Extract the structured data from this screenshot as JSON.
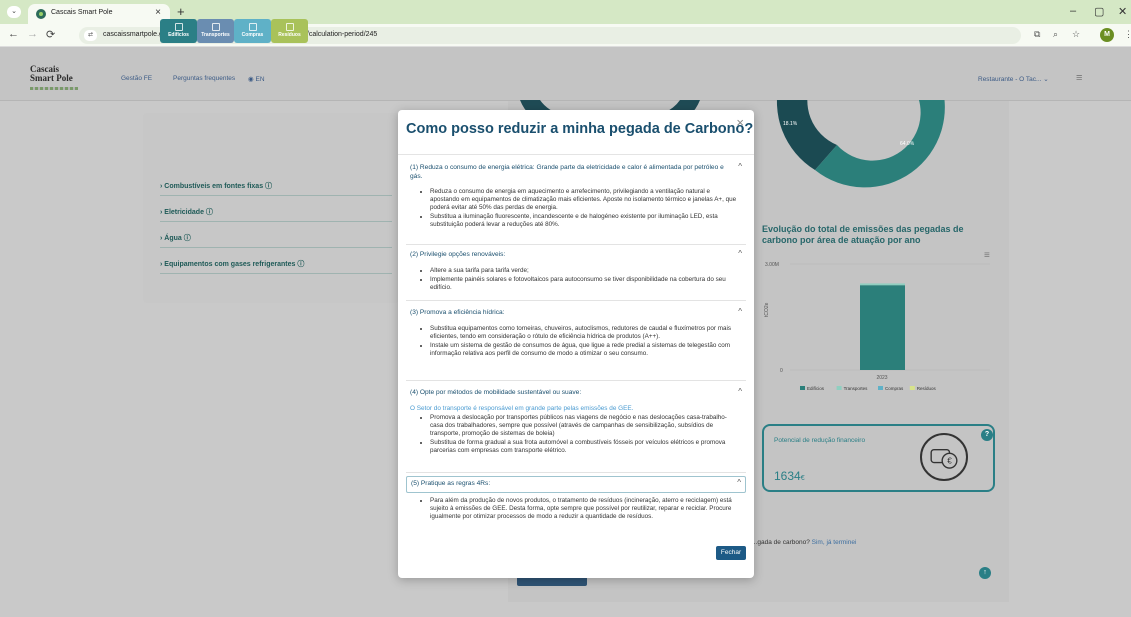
{
  "browser": {
    "tab_title": "Cascais Smart Pole",
    "url": "cascaissmartpole.get2zero.pt/collection-and-calculation/entity/101/calculation-period/245",
    "profile_initial": "M",
    "tab_close": "×",
    "new_tab": "+",
    "win_minimize": "–",
    "win_maximize": "▢",
    "win_close": "✕"
  },
  "app": {
    "logo_line1": "Cascais",
    "logo_line2": "Smart Pole",
    "nav": [
      "Gestão FE",
      "Perguntas frequentes"
    ],
    "lang": "EN",
    "restaurant_select": "Restaurante - O Tac...",
    "hamburger": "≡"
  },
  "categories": [
    {
      "label": "Edifícios",
      "color": "#2b7f86"
    },
    {
      "label": "Transportes",
      "color": "#6a8db1"
    },
    {
      "label": "Compras",
      "color": "#5fb1c7"
    },
    {
      "label": "Resíduos",
      "color": "#a9c25a"
    }
  ],
  "accordion": [
    "Combustíveis em fontes fixas",
    "Eletricidade",
    "Água",
    "Equipamentos com gases refrigerantes"
  ],
  "chart": {
    "title": "Evolução do total de emissões das pegadas de carbono por área de atuação por ano",
    "y_tick_top": "3.00M",
    "y_tick_bottom": "0",
    "y_label": "tCO2e",
    "x_label": "2023",
    "legend": [
      "Edifícios",
      "Transportes",
      "Compras",
      "Resíduos"
    ],
    "donut_labels": [
      "18.1%",
      "64.0%"
    ]
  },
  "chart_data": {
    "type": "bar",
    "categories": [
      "2023"
    ],
    "series": [
      {
        "name": "Edifícios",
        "values": [
          2.4
        ]
      },
      {
        "name": "Transportes",
        "values": [
          0.05
        ]
      },
      {
        "name": "Compras",
        "values": [
          0.0
        ]
      },
      {
        "name": "Resíduos",
        "values": [
          0.0
        ]
      }
    ],
    "ylim": [
      0,
      3.0
    ],
    "ylabel": "tCO2e",
    "title": "Evolução do total de emissões das pegadas de carbono por área de atuação por ano",
    "legend_placement": "bottom"
  },
  "financial": {
    "label": "Potencial de redução financeiro",
    "value": "1634",
    "unit": "€"
  },
  "bottom": {
    "question": "...gada de carbono?",
    "link": "Sim, já terminei"
  },
  "modal": {
    "title": "Como posso reduzir a minha pegada de Carbono?",
    "close": "×",
    "sections": [
      {
        "head": "(1) Reduza o consumo de energia elétrica: Grande parte da eletricidade e calor é alimentada por petróleo e gás.",
        "items": [
          "Reduza o consumo de energia em aquecimento e arrefecimento, privilegiando a ventilação natural e apostando em equipamentos de climatização mais eficientes. Aposte no isolamento térmico e janelas A+, que poderá evitar até 50% das perdas de energia.",
          "Substitua a iluminação fluorescente, incandescente e de halogéneo existente por iluminação LED, esta substituição poderá levar a reduções até 80%."
        ]
      },
      {
        "head": "(2) Privilegie opções renováveis:",
        "items": [
          "Altere a sua tarifa para tarifa verde;",
          "Implemente painéis solares e fotovoltaicos para autoconsumo se tiver disponibilidade na cobertura do seu edifício."
        ]
      },
      {
        "head": "(3) Promova a eficiência hídrica:",
        "items": [
          "Substitua equipamentos como torneiras, chuveiros, autoclismos, redutores de caudal e fluxímetros por mais eficientes, tendo em consideração o rótulo de eficiência hídrica de produtos (A++).",
          "Instale um sistema de gestão de consumos de água, que ligue a rede predial a sistemas de telegestão com informação relativa aos perfil de consumo de modo a otimizar o seu consumo."
        ]
      },
      {
        "head": "(4) Opte por métodos de mobilidade sustentável ou suave:",
        "note": "O Setor do transporte é responsável em grande parte pelas emissões de GEE.",
        "items": [
          "Promova a deslocação por transportes públicos nas viagens de negócio e nas deslocações casa-trabalho-casa dos trabalhadores, sempre que possível (através de campanhas de sensibilização, subsídios de transporte, promoção de sistemas de boleia)",
          "Substitua de forma gradual a sua frota automóvel a combustíveis fósseis por veículos elétricos e promova parcerias com empresas com transporte elétrico."
        ]
      },
      {
        "head": "(5) Pratique as regras 4Rs:",
        "items": [
          "Para além da produção de novos produtos, o tratamento de resíduos (incineração, aterro e reciclagem) está sujeito à emissões de GEE. Desta forma, opte sempre que possível por reutilizar, reparar e reciclar. Procure igualmente por otimizar processos de modo a reduzir a quantidade de resíduos."
        ]
      }
    ],
    "close_button": "Fechar"
  }
}
